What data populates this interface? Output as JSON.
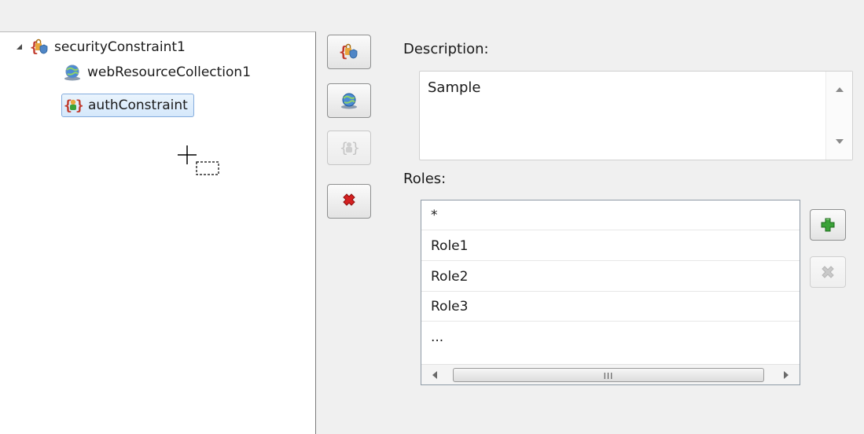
{
  "tree": {
    "items": [
      {
        "label": "securityConstraint1",
        "icon": "security-constraint-icon",
        "expanded": true
      },
      {
        "label": "webResourceCollection1",
        "icon": "web-resource-collection-icon"
      },
      {
        "label": "authConstraint",
        "icon": "auth-constraint-icon",
        "selected": true
      }
    ]
  },
  "toolbar": {
    "buttons": [
      {
        "icon": "add-security-constraint-icon",
        "enabled": true
      },
      {
        "icon": "add-web-resource-collection-icon",
        "enabled": true
      },
      {
        "icon": "add-auth-constraint-icon",
        "enabled": false
      },
      {
        "icon": "delete-icon",
        "enabled": true
      }
    ]
  },
  "description": {
    "label": "Description:",
    "value": "Sample"
  },
  "roles": {
    "label": "Roles:",
    "items": [
      "*",
      "Role1",
      "Role2",
      "Role3",
      "..."
    ],
    "scroll_grip": "III",
    "add_icon": "add-role-icon",
    "remove_icon": "remove-role-icon"
  },
  "colors": {
    "selection_border": "#84acdd",
    "delete_red": "#d42020",
    "add_green": "#3aa238"
  }
}
